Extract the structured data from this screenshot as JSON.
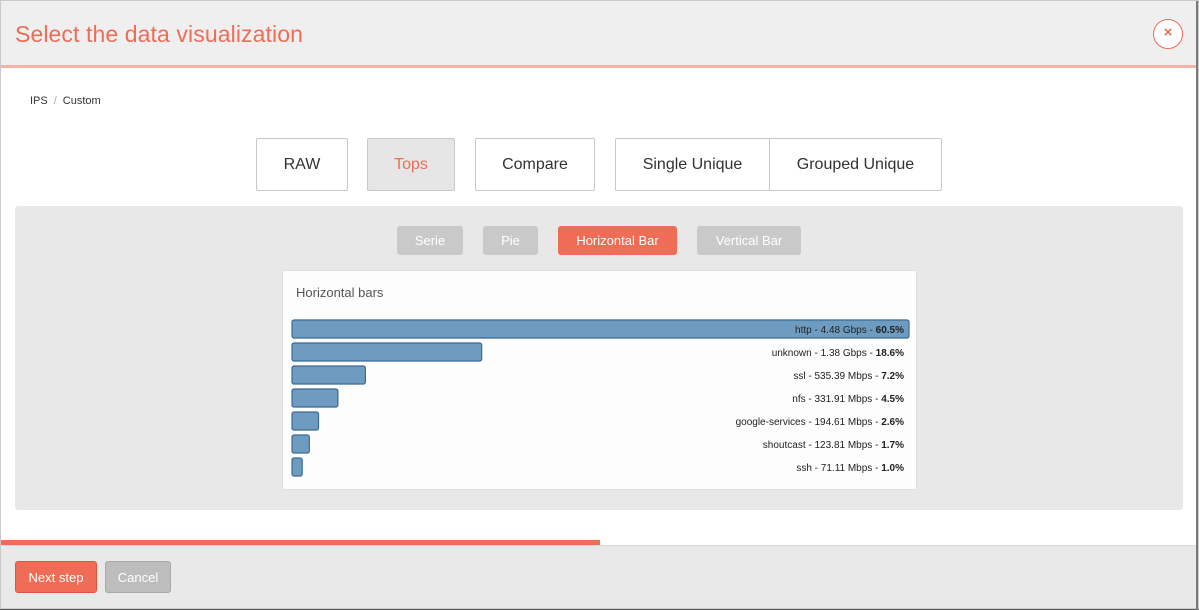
{
  "header": {
    "title": "Select the data visualization",
    "close_symbol": "×"
  },
  "breadcrumb": {
    "items": [
      "IPS",
      "Custom"
    ],
    "separator": "/"
  },
  "modes": {
    "raw": "RAW",
    "tops": "Tops",
    "compare": "Compare",
    "single_unique": "Single Unique",
    "grouped_unique": "Grouped Unique",
    "active": "tops"
  },
  "visualizations": {
    "serie": "Serie",
    "pie": "Pie",
    "horizontal_bar": "Horizontal Bar",
    "vertical_bar": "Vertical Bar",
    "active": "horizontal_bar"
  },
  "colors": {
    "accent": "#ef6c56",
    "bar_fill": "#6e9cc1",
    "bar_stroke": "#3d6a92"
  },
  "chart_data": {
    "type": "bar",
    "orientation": "horizontal",
    "title": "Horizontal bars",
    "categories": [
      "http",
      "unknown",
      "ssl",
      "nfs",
      "google-services",
      "shoutcast",
      "ssh"
    ],
    "rates": [
      "4.48 Gbps",
      "1.38 Gbps",
      "535.39 Mbps",
      "331.91 Mbps",
      "194.61 Mbps",
      "123.81 Mbps",
      "71.11 Mbps"
    ],
    "percent_labels": [
      "60.5%",
      "18.6%",
      "7.2%",
      "4.5%",
      "2.6%",
      "1.7%",
      "1.0%"
    ],
    "values": [
      60.5,
      18.6,
      7.2,
      4.5,
      2.6,
      1.7,
      1.0
    ]
  },
  "footer": {
    "next_label": "Next step",
    "cancel_label": "Cancel",
    "progress": 0.5
  }
}
